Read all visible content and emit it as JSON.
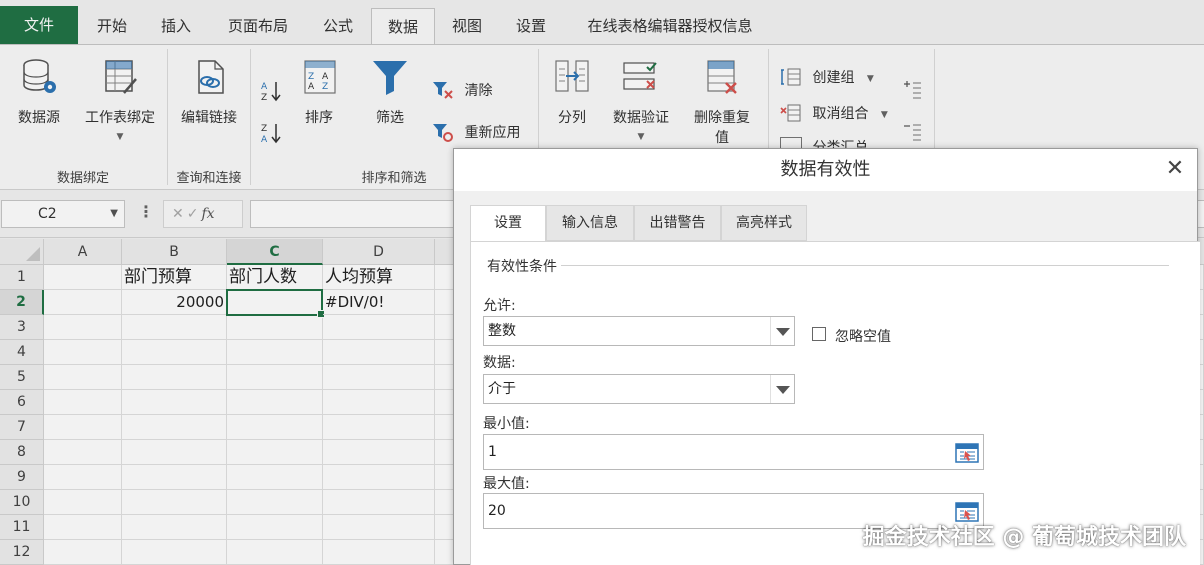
{
  "menu": {
    "tabs": [
      "文件",
      "开始",
      "插入",
      "页面布局",
      "公式",
      "数据",
      "视图",
      "设置",
      "在线表格编辑器授权信息"
    ],
    "active_tab": "数据"
  },
  "ribbon": {
    "data_source": "数据源",
    "bind_sheet": "工作表绑定",
    "edit_links": "编辑链接",
    "sort": "排序",
    "filter": "筛选",
    "clear": "清除",
    "reapply": "重新应用",
    "split_column": "分列",
    "data_validation": "数据验证",
    "remove_duplicates_line1": "删除重复",
    "remove_duplicates_line2": "值",
    "group": "创建组",
    "ungroup": "取消组合",
    "subtotal": "分类汇总",
    "groups": {
      "data_binding": "数据绑定",
      "query_connect": "查询和连接",
      "sort_filter": "排序和筛选"
    }
  },
  "formula_bar": {
    "name_box": "C2",
    "fx_label": "fx",
    "formula": ""
  },
  "sheet": {
    "columns": [
      "A",
      "B",
      "C",
      "D"
    ],
    "selected_column": "C",
    "rows": [
      "1",
      "2",
      "3",
      "4",
      "5",
      "6",
      "7",
      "8",
      "9",
      "10",
      "11",
      "12"
    ],
    "selected_row": "2",
    "cells": {
      "B1": "部门预算",
      "C1": "部门人数",
      "D1": "人均预算",
      "B2": "20000",
      "C2": "",
      "D2": "#DIV/0!"
    }
  },
  "dialog": {
    "title": "数据有效性",
    "tabs": [
      "设置",
      "输入信息",
      "出错警告",
      "高亮样式"
    ],
    "active_tab": "设置",
    "section_title": "有效性条件",
    "allow_label": "允许:",
    "allow_value": "整数",
    "ignore_blank_label": "忽略空值",
    "ignore_blank_checked": false,
    "data_label": "数据:",
    "data_value": "介于",
    "min_label": "最小值:",
    "min_value": "1",
    "max_label": "最大值:",
    "max_value": "20"
  },
  "watermark": "掘金技术社区 @ 葡萄城技术团队",
  "colors": {
    "accent_green": "#217346",
    "filter_blue": "#2e75b6",
    "error_red": "#d9534f"
  }
}
